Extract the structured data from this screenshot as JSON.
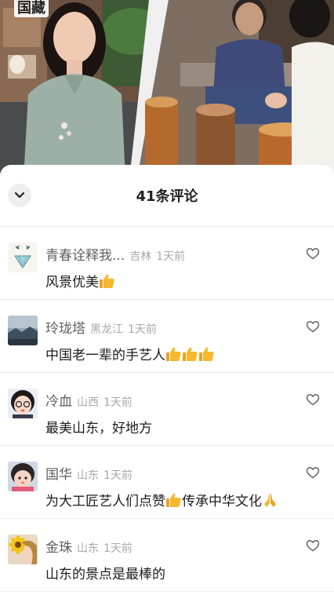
{
  "video": {
    "watermark": "国藏"
  },
  "comments_sheet": {
    "title": "41条评论",
    "comments": [
      {
        "nickname": "青春诠释我...",
        "region": "吉林",
        "time": "1天前",
        "text": "风景优美",
        "emojis": [
          "thumbs-up"
        ]
      },
      {
        "nickname": "玲珑塔",
        "region": "黑龙江",
        "time": "1天前",
        "text": "中国老一辈的手艺人",
        "emojis": [
          "thumbs-up",
          "thumbs-up",
          "thumbs-up"
        ]
      },
      {
        "nickname": "冷血",
        "region": "山西",
        "time": "1天前",
        "text": "最美山东，好地方",
        "emojis": []
      },
      {
        "nickname": "国华",
        "region": "山东",
        "time": "1天前",
        "text": "为大工匠艺人们点赞",
        "text_after": "传承中华文化",
        "emojis": [
          "thumbs-up",
          "pray"
        ]
      },
      {
        "nickname": "金珠",
        "region": "山东",
        "time": "1天前",
        "text": "山东的景点是最棒的",
        "emojis": []
      }
    ]
  },
  "colors": {
    "nickname": "#5f5f5f",
    "meta": "#a8a8a8",
    "text": "#1c1c1c",
    "emoji": "#f5b82e"
  }
}
